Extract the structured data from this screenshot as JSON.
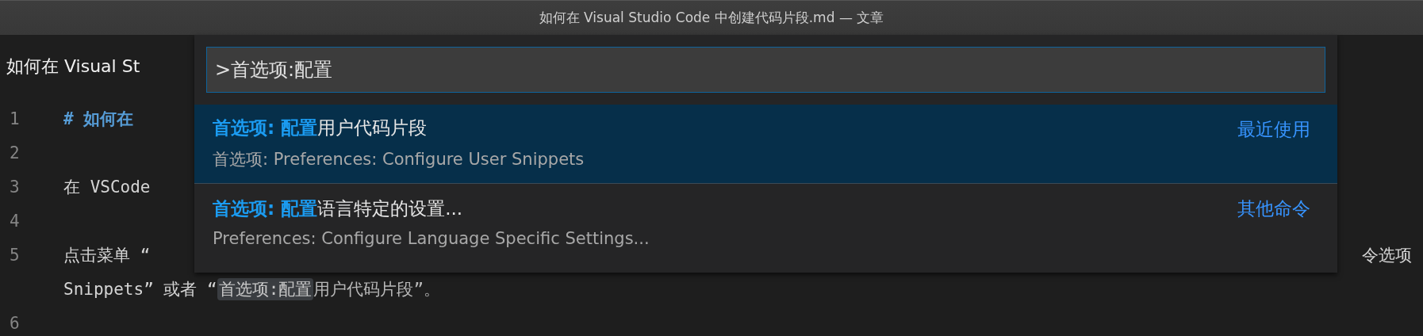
{
  "window": {
    "title": "如何在 Visual Studio Code 中创建代码片段.md — 文章"
  },
  "editor": {
    "tab_title": "如何在 Visual St",
    "lines": [
      {
        "number": "1",
        "kind": "heading",
        "text": "# 如何在"
      },
      {
        "number": "2",
        "kind": "blank"
      },
      {
        "number": "3",
        "kind": "plain",
        "text": "在 VSCode"
      },
      {
        "number": "4",
        "kind": "blank"
      },
      {
        "number": "5",
        "kind": "plain",
        "text": "点击菜单 “",
        "text_right": "令选项"
      },
      {
        "kind": "wrap",
        "text": "Snippets” 或者 “",
        "code": "首选项:配置",
        "text_after": "用户代码片段”。"
      },
      {
        "number": "6",
        "kind": "blank"
      }
    ]
  },
  "command_palette": {
    "input": {
      "value": ">首选项:配置"
    },
    "items": [
      {
        "label": "**首选项: 配置**用户代码片段",
        "detail": "首选项: Preferences: Configure User Snippets",
        "tag": "最近使用",
        "selected": true
      },
      {
        "label": "**首选项: 配置**语言特定的设置...",
        "detail": "Preferences: Configure Language Specific Settings...",
        "tag": "其他命令",
        "selected": false
      }
    ]
  }
}
